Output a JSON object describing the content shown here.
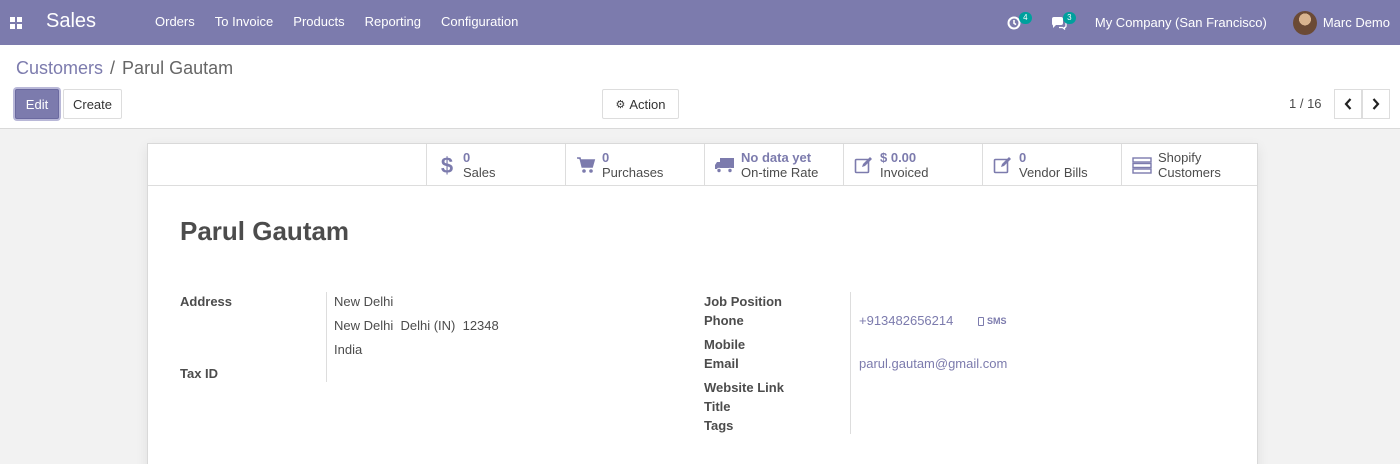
{
  "navbar": {
    "app_title": "Sales",
    "menu": [
      "Orders",
      "To Invoice",
      "Products",
      "Reporting",
      "Configuration"
    ],
    "activity_count": "4",
    "messages_count": "3",
    "company": "My Company (San Francisco)",
    "user": "Marc Demo"
  },
  "breadcrumb": {
    "parent": "Customers",
    "separator": "/",
    "current": "Parul Gautam"
  },
  "buttons": {
    "edit": "Edit",
    "create": "Create",
    "action": "Action"
  },
  "pager": {
    "value": "1 / 16"
  },
  "stat_buttons": [
    {
      "value": "0",
      "label": "Sales",
      "icon": "dollar-icon"
    },
    {
      "value": "0",
      "label": "Purchases",
      "icon": "cart-icon"
    },
    {
      "value": "No data yet",
      "label": "On-time Rate",
      "icon": "truck-icon"
    },
    {
      "value": "$ 0.00",
      "label": "Invoiced",
      "icon": "edit-icon"
    },
    {
      "value": "0",
      "label": "Vendor Bills",
      "icon": "edit-icon"
    },
    {
      "value": "Shopify",
      "label": "Customers",
      "icon": "server-icon"
    }
  ],
  "partner": {
    "name": "Parul Gautam",
    "labels": {
      "address": "Address",
      "tax_id": "Tax ID",
      "job_position": "Job Position",
      "phone": "Phone",
      "mobile": "Mobile",
      "email": "Email",
      "website": "Website Link",
      "title": "Title",
      "tags": "Tags"
    },
    "address_line1": "New Delhi",
    "address_line2": "New Delhi  Delhi (IN)  12348",
    "address_line3": "India",
    "phone": "+913482656214",
    "sms_label": "SMS",
    "email": "parul.gautam@gmail.com"
  },
  "colors": {
    "brand": "#7c7bad",
    "badge": "#00a09d"
  }
}
